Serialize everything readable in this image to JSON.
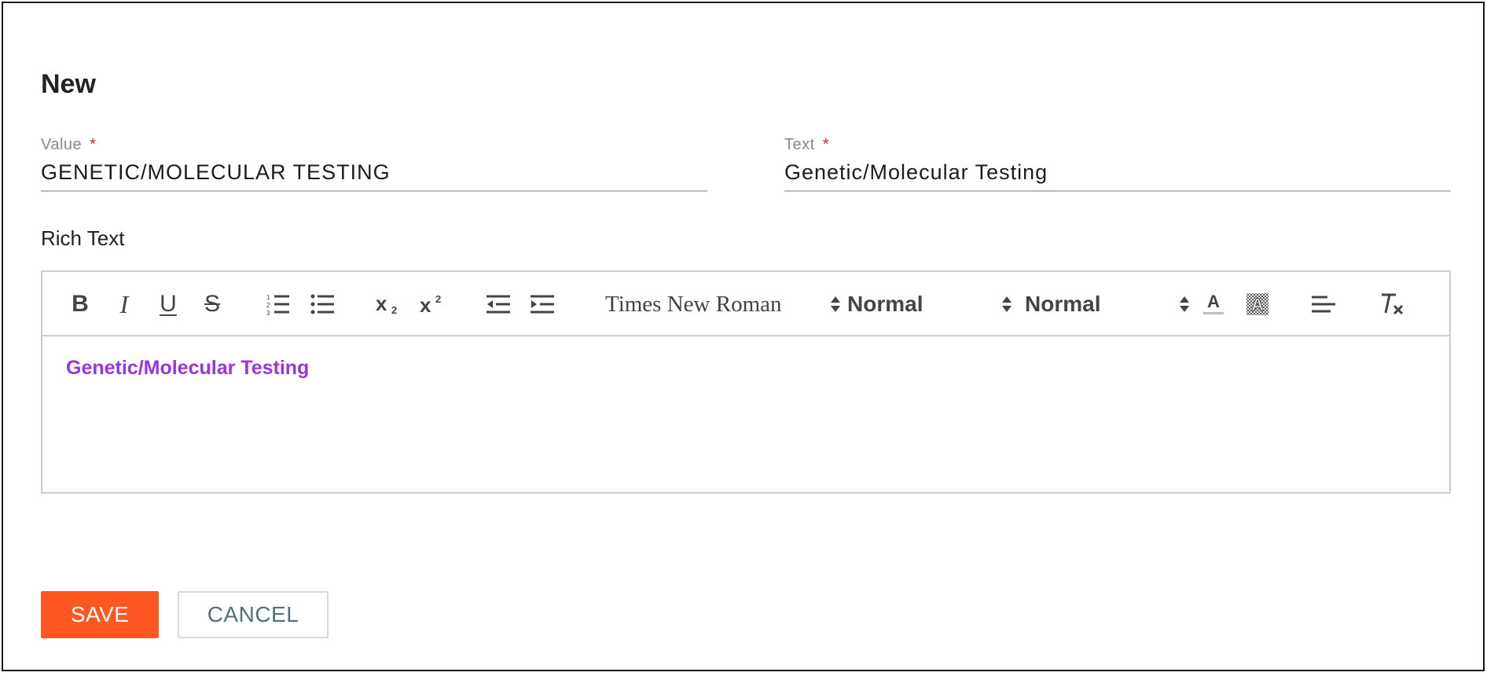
{
  "dialog": {
    "title": "New"
  },
  "value_field": {
    "label": "Value",
    "required_mark": "*",
    "value": "GENETIC/MOLECULAR TESTING"
  },
  "text_field": {
    "label": "Text",
    "required_mark": "*",
    "value": "Genetic/Molecular Testing"
  },
  "rich_text": {
    "label": "Rich Text",
    "toolbar": {
      "bold_label": "B",
      "italic_label": "I",
      "underline_label": "U",
      "strike_label": "S",
      "font_select": "Times New Roman",
      "size_select": "Normal",
      "header_select": "Normal",
      "icons": [
        "bold-icon",
        "italic-icon",
        "underline-icon",
        "strike-icon",
        "ordered-list-icon",
        "bullet-list-icon",
        "subscript-icon",
        "superscript-icon",
        "outdent-icon",
        "indent-icon",
        "font-color-icon",
        "background-color-icon",
        "align-icon",
        "clear-format-icon"
      ]
    },
    "content": "Genetic/Molecular Testing",
    "content_color": "#9b34e0"
  },
  "actions": {
    "save_label": "SAVE",
    "cancel_label": "CANCEL",
    "save_color": "#ff5722"
  }
}
